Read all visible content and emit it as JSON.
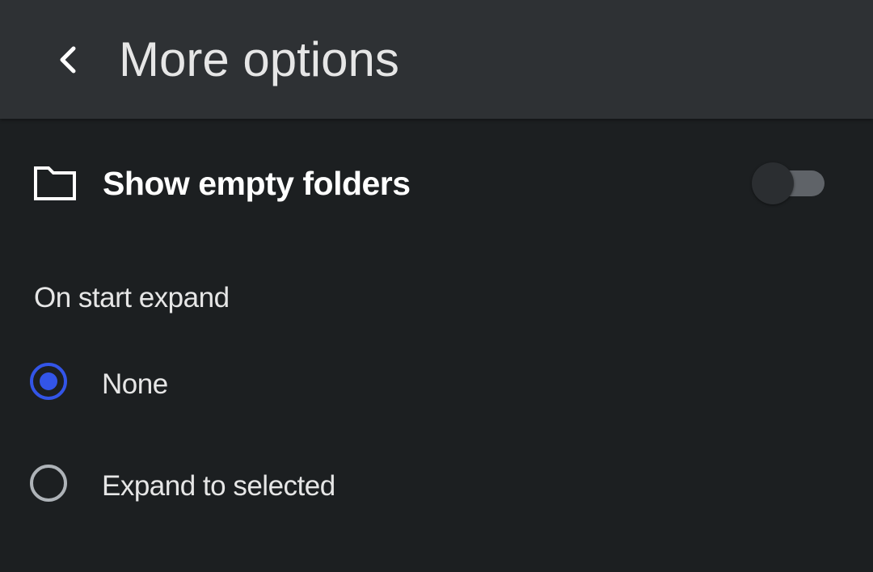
{
  "header": {
    "back_icon": "chevron-left-icon",
    "title": "More options"
  },
  "settings": {
    "show_empty_folders": {
      "icon": "folder-icon",
      "label": "Show empty folders",
      "enabled": false
    },
    "on_start_expand": {
      "heading": "On start expand",
      "options": [
        {
          "label": "None",
          "selected": true
        },
        {
          "label": "Expand to selected",
          "selected": false
        }
      ]
    }
  },
  "colors": {
    "background": "#1c1f21",
    "header_background": "#2e3134",
    "accent": "#3355e8",
    "switch_track_off": "#5f6368"
  }
}
